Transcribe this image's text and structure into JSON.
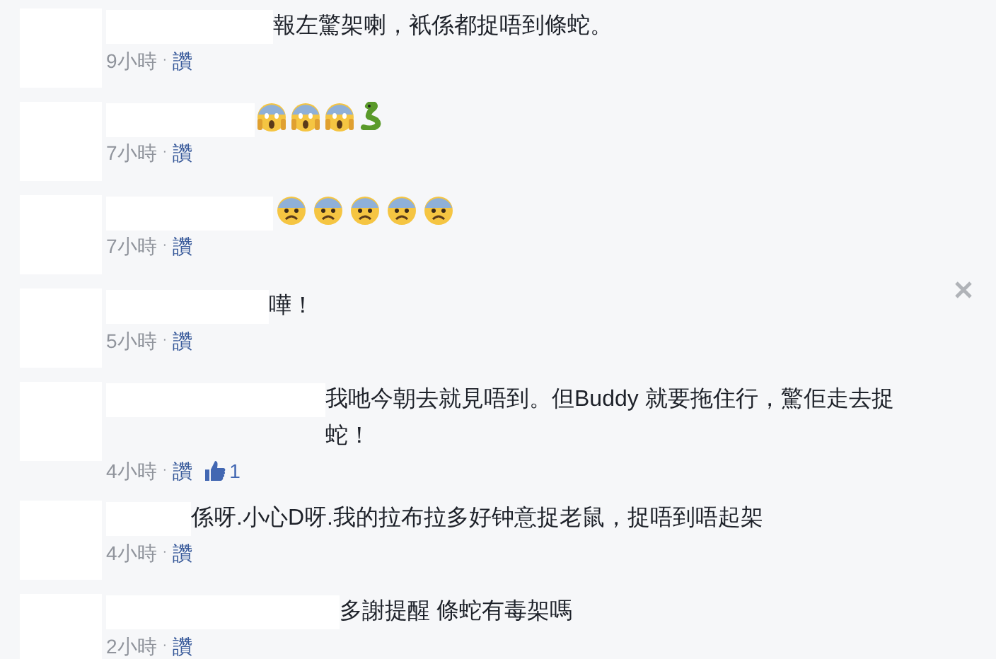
{
  "comments": [
    {
      "text": "報左驚架喇，衹係都捉唔到條蛇。",
      "time": "9小時",
      "separator": "·",
      "like_label": "讚"
    },
    {
      "emojis": [
        {
          "kind": "scream"
        },
        {
          "kind": "scream"
        },
        {
          "kind": "scream"
        },
        {
          "kind": "snake"
        }
      ],
      "time": "7小時",
      "separator": "·",
      "like_label": "讚"
    },
    {
      "emojis": [
        {
          "kind": "fearful"
        },
        {
          "kind": "fearful"
        },
        {
          "kind": "fearful"
        },
        {
          "kind": "fearful"
        },
        {
          "kind": "fearful"
        }
      ],
      "time": "7小時",
      "separator": "·",
      "like_label": "讚"
    },
    {
      "text": "嘩！",
      "time": "5小時",
      "separator": "·",
      "like_label": "讚",
      "closable": true
    },
    {
      "text": "我吔今朝去就見唔到。但Buddy 就要拖住行，驚佢走去捉蛇！",
      "time": "4小時",
      "separator": "·",
      "like_label": "讚",
      "likes": "1"
    },
    {
      "text": "係呀.小心D呀.我的拉布拉多好钟意捉老鼠，捉唔到唔起架",
      "time": "4小時",
      "separator": "·",
      "like_label": "讚"
    },
    {
      "text": "多謝提醒 條蛇有毒架嗎",
      "time": "2小時",
      "separator": "·",
      "like_label": "讚"
    }
  ]
}
